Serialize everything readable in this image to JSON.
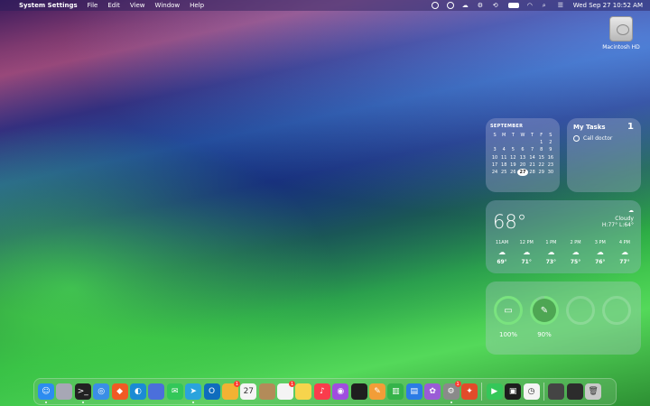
{
  "menubar": {
    "app_name": "System Settings",
    "items": [
      "File",
      "Edit",
      "View",
      "Window",
      "Help"
    ],
    "clock": "Wed Sep 27  10:52 AM"
  },
  "desktop": {
    "drive_label": "Macintosh HD"
  },
  "calendar_widget": {
    "month": "SEPTEMBER",
    "weekdays": [
      "S",
      "M",
      "T",
      "W",
      "T",
      "F",
      "S"
    ],
    "weeks": [
      [
        "",
        "",
        "",
        "",
        "",
        "1",
        "2"
      ],
      [
        "3",
        "4",
        "5",
        "6",
        "7",
        "8",
        "9"
      ],
      [
        "10",
        "11",
        "12",
        "13",
        "14",
        "15",
        "16"
      ],
      [
        "17",
        "18",
        "19",
        "20",
        "21",
        "22",
        "23"
      ],
      [
        "24",
        "25",
        "26",
        "27",
        "28",
        "29",
        "30"
      ]
    ],
    "today": "27"
  },
  "tasks_widget": {
    "title": "My Tasks",
    "count": "1",
    "task": "Call doctor"
  },
  "weather_widget": {
    "temp": "68°",
    "condition": "Cloudy",
    "hilo": "H:77° L:64°",
    "hours": [
      {
        "time": "11AM",
        "temp": "69°"
      },
      {
        "time": "12 PM",
        "temp": "71°"
      },
      {
        "time": "1 PM",
        "temp": "73°"
      },
      {
        "time": "2 PM",
        "temp": "75°"
      },
      {
        "time": "3 PM",
        "temp": "76°"
      },
      {
        "time": "4 PM",
        "temp": "77°"
      }
    ]
  },
  "battery_widget": {
    "devices": [
      {
        "icon": "laptop-icon",
        "level": 100,
        "label": "100%"
      },
      {
        "icon": "pencil-icon",
        "level": 90,
        "label": "90%"
      }
    ]
  },
  "dock": {
    "apps": [
      {
        "name": "finder",
        "color": "#2d8cf0",
        "running": true
      },
      {
        "name": "launchpad",
        "color": "#a7a7b5",
        "running": false
      },
      {
        "name": "terminal",
        "color": "#222",
        "running": true
      },
      {
        "name": "safari",
        "color": "#3a8ee6",
        "running": false
      },
      {
        "name": "brave",
        "color": "#f05a24",
        "running": false
      },
      {
        "name": "edge",
        "color": "#1b8bd4",
        "running": false
      },
      {
        "name": "preview",
        "color": "#4b6fdb",
        "running": false
      },
      {
        "name": "messages",
        "color": "#33c759",
        "running": false
      },
      {
        "name": "telegram",
        "color": "#2aa3dd",
        "running": true
      },
      {
        "name": "outlook",
        "color": "#0f6cbd",
        "running": false
      },
      {
        "name": "photos",
        "color": "#f2b233",
        "running": false,
        "badge": "1"
      },
      {
        "name": "calendar",
        "color": "#f4f4f4",
        "running": false
      },
      {
        "name": "archive",
        "color": "#b38b59",
        "running": false
      },
      {
        "name": "reminders",
        "color": "#f4f4f4",
        "running": false,
        "badge": "1"
      },
      {
        "name": "notes",
        "color": "#f7d44c",
        "running": false
      },
      {
        "name": "music",
        "color": "#fa3c4c",
        "running": false
      },
      {
        "name": "podcasts",
        "color": "#a04ddf",
        "running": false
      },
      {
        "name": "tv",
        "color": "#1f1f1f",
        "running": false
      },
      {
        "name": "pages",
        "color": "#f29d38",
        "running": false
      },
      {
        "name": "numbers",
        "color": "#35b34a",
        "running": false
      },
      {
        "name": "keynote",
        "color": "#2c7be5",
        "running": false
      },
      {
        "name": "flower",
        "color": "#9a5cd6",
        "running": false
      },
      {
        "name": "system-settings",
        "color": "#8a8a8a",
        "running": true,
        "badge": "1"
      },
      {
        "name": "compass",
        "color": "#e24b2a",
        "running": false
      },
      {
        "name": "facetime",
        "color": "#34c759",
        "running": false
      },
      {
        "name": "activity-monitor",
        "color": "#1d1d1d",
        "running": false
      },
      {
        "name": "clock",
        "color": "#f4f4f4",
        "running": false
      },
      {
        "name": "mini-window",
        "color": "#444",
        "running": false
      },
      {
        "name": "dark-window",
        "color": "#2c2c2c",
        "running": false
      },
      {
        "name": "trash",
        "color": "#c9c9c9",
        "running": false
      }
    ]
  }
}
